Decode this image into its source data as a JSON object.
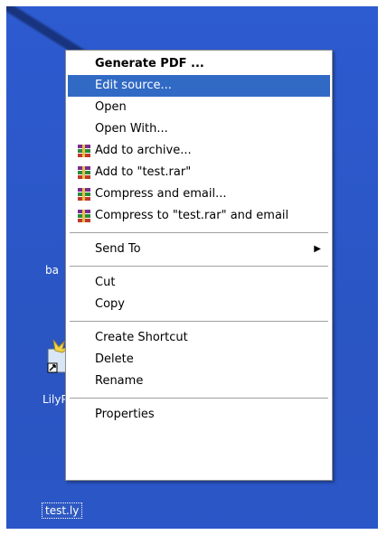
{
  "desktop": {
    "labels": {
      "partial_1": "ba",
      "partial_2": "LilyP",
      "selected_file": "test.ly"
    }
  },
  "menu": {
    "items": [
      {
        "label": "Generate PDF ...",
        "bold": true
      },
      {
        "label": "Edit source...",
        "highlight": true
      },
      {
        "label": "Open"
      },
      {
        "label": "Open With..."
      },
      {
        "label": "Add to archive...",
        "icon": "winrar-icon"
      },
      {
        "label": "Add to \"test.rar\"",
        "icon": "winrar-icon"
      },
      {
        "label": "Compress and email...",
        "icon": "winrar-icon"
      },
      {
        "label": "Compress to \"test.rar\" and email",
        "icon": "winrar-icon"
      },
      {
        "label": "Send To",
        "submenu": true
      },
      {
        "label": "Cut"
      },
      {
        "label": "Copy"
      },
      {
        "label": "Create Shortcut"
      },
      {
        "label": "Delete"
      },
      {
        "label": "Rename"
      },
      {
        "label": "Properties"
      }
    ]
  },
  "colors": {
    "desktop_blue": "#2b57c8",
    "highlight": "#316ac5"
  }
}
